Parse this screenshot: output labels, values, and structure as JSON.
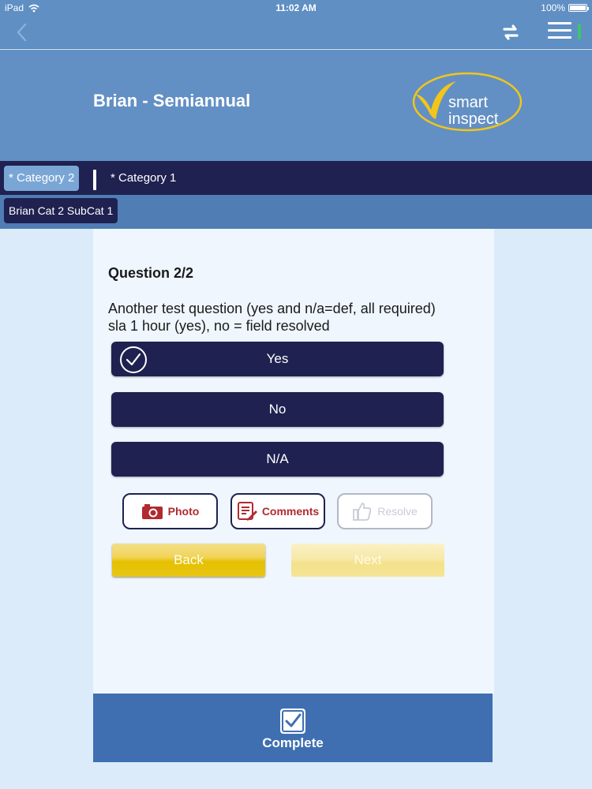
{
  "status_bar": {
    "device": "iPad",
    "time": "11:02 AM",
    "battery": "100%"
  },
  "header": {
    "title": "Brian - Semiannual",
    "logo_text_1": "smart",
    "logo_text_2": "inspect"
  },
  "categories": [
    {
      "label": "* Category 2",
      "active": true
    },
    {
      "label": "* Category 1",
      "active": false
    }
  ],
  "subcategory": {
    "label": "Brian Cat 2 SubCat 1"
  },
  "question": {
    "number": "Question 2/2",
    "text": "Another test question (yes and n/a=def, all required) sla 1 hour (yes), no = field resolved"
  },
  "answers": [
    {
      "label": "Yes",
      "selected": true
    },
    {
      "label": "No",
      "selected": false
    },
    {
      "label": "N/A",
      "selected": false
    }
  ],
  "actions": {
    "photo": "Photo",
    "comments": "Comments",
    "resolve": "Resolve"
  },
  "navigation": {
    "back": "Back",
    "next": "Next"
  },
  "complete": {
    "label": "Complete"
  },
  "colors": {
    "nav_dark": "#1f2150",
    "header_blue": "#6390c4",
    "accent_yellow": "#e5c000",
    "icon_red": "#b02a30"
  }
}
